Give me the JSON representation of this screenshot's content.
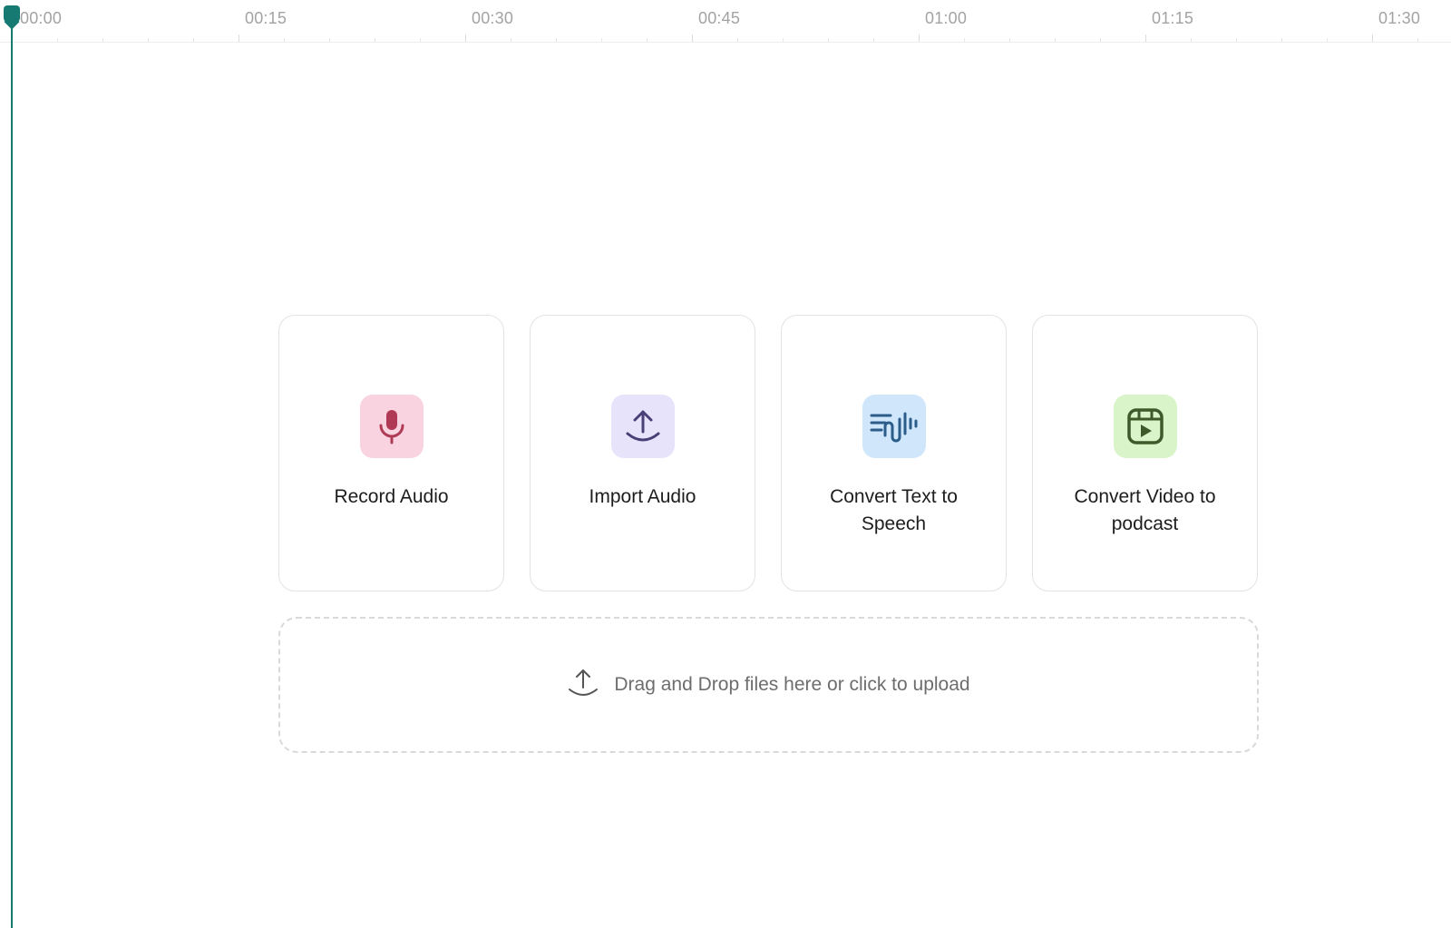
{
  "timeline": {
    "ticks": [
      "00:00",
      "00:15",
      "00:30",
      "00:45",
      "01:00",
      "01:15",
      "01:30"
    ]
  },
  "colors": {
    "playhead": "#177a72",
    "record_bg": "#f9d3df",
    "record_fg": "#b03a55",
    "import_bg": "#e6e3fb",
    "import_fg": "#4b3f78",
    "tts_bg": "#cfe6fb",
    "tts_fg": "#2b5c8a",
    "video_bg": "#d9f4c9",
    "video_fg": "#3d5a2b"
  },
  "cards": [
    {
      "label": "Record Audio",
      "icon": "microphone-icon"
    },
    {
      "label": "Import Audio",
      "icon": "upload-icon"
    },
    {
      "label": "Convert Text to Speech",
      "icon": "text-to-speech-icon"
    },
    {
      "label": "Convert Video to podcast",
      "icon": "video-reel-icon"
    }
  ],
  "dropzone": {
    "text": "Drag and Drop files here or click to upload",
    "icon": "upload-arrow-icon"
  }
}
